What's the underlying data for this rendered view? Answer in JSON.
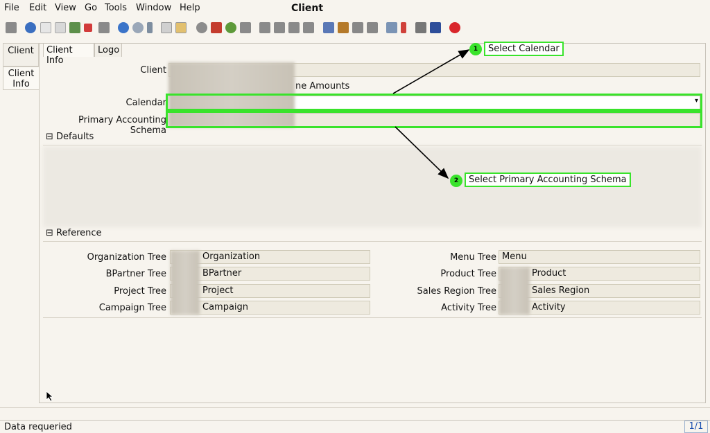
{
  "window_title": "Client",
  "menu": [
    "File",
    "Edit",
    "View",
    "Go",
    "Tools",
    "Window",
    "Help"
  ],
  "side_tabs": {
    "client": "Client",
    "client_info_line1": "Client",
    "client_info_line2": "Info"
  },
  "tabs": {
    "client_info": "Client Info",
    "logo": "Logo"
  },
  "fields": {
    "client_label": "Client",
    "amounts_text": "ne Amounts",
    "calendar_label": "Calendar",
    "primary_schema_label": "Primary Accounting Schema"
  },
  "sections": {
    "defaults": "Defaults",
    "reference": "Reference"
  },
  "reference": {
    "org_tree_label": "Organization Tree",
    "org_tree_value": "Organization",
    "bpartner_tree_label": "BPartner Tree",
    "bpartner_tree_value": "BPartner",
    "project_tree_label": "Project Tree",
    "project_tree_value": "Project",
    "campaign_tree_label": "Campaign Tree",
    "campaign_tree_value": "Campaign",
    "menu_tree_label": "Menu Tree",
    "menu_tree_value": "Menu",
    "product_tree_label": "Product Tree",
    "product_tree_value": "Product",
    "sales_region_tree_label": "Sales Region Tree",
    "sales_region_tree_value": "Sales Region",
    "activity_tree_label": "Activity Tree",
    "activity_tree_value": "Activity"
  },
  "callouts": {
    "one_num": "1",
    "one_text": "Select Calendar",
    "two_num": "2",
    "two_text": "Select Primary Accounting Schema"
  },
  "status": {
    "text": "Data requeried",
    "page": "1/1"
  },
  "colors": {
    "highlight": "#39e32b",
    "close_icon": "#d9262b"
  }
}
